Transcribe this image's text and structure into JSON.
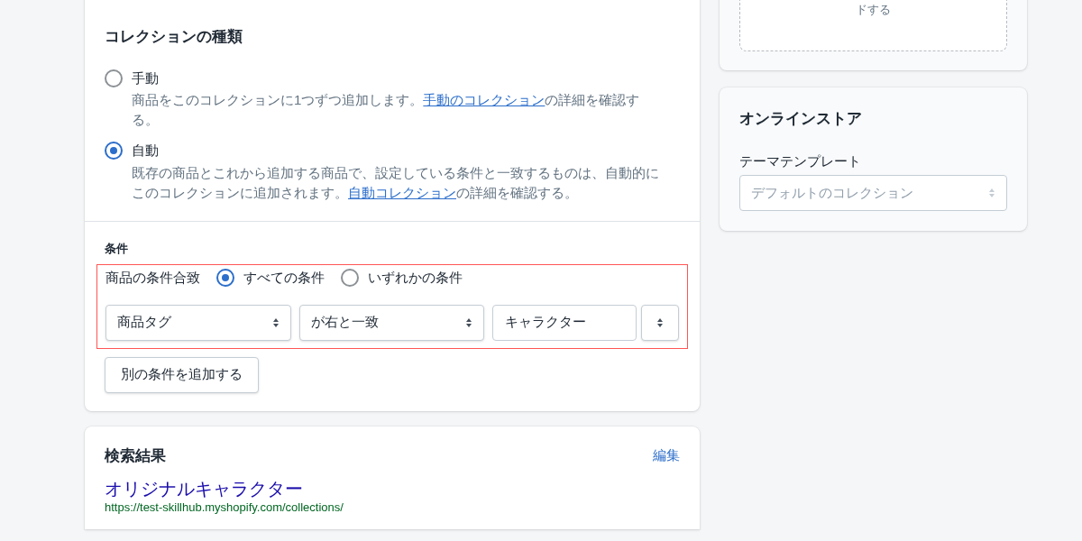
{
  "upload_box": {
    "text": "ドする"
  },
  "collection_type": {
    "title": "コレクションの種類",
    "options": [
      {
        "label": "手動",
        "selected": false,
        "description_before": "商品をこのコレクションに1つずつ追加します。",
        "link": "手動のコレクション",
        "description_after": "の詳細を確認する。"
      },
      {
        "label": "自動",
        "selected": true,
        "description_before": "既存の商品とこれから追加する商品で、設定している条件と一致するものは、自動的にこのコレクションに追加されます。",
        "link": "自動コレクション",
        "description_after": "の詳細を確認する。"
      }
    ]
  },
  "conditions": {
    "title": "条件",
    "match_label": "商品の条件合致",
    "match_options": [
      {
        "label": "すべての条件",
        "selected": true
      },
      {
        "label": "いずれかの条件",
        "selected": false
      }
    ],
    "rules": [
      {
        "column": "商品タグ",
        "relation": "が右と一致",
        "value": "キャラクター"
      }
    ],
    "add_button": "別の条件を追加する"
  },
  "search_results": {
    "title": "検索結果",
    "edit_link": "編集",
    "page_title": "オリジナルキャラクター",
    "url": "https://test-skillhub.myshopify.com/collections/"
  },
  "online_store": {
    "title": "オンラインストア",
    "template_label": "テーマテンプレート",
    "template_value": "デフォルトのコレクション"
  }
}
